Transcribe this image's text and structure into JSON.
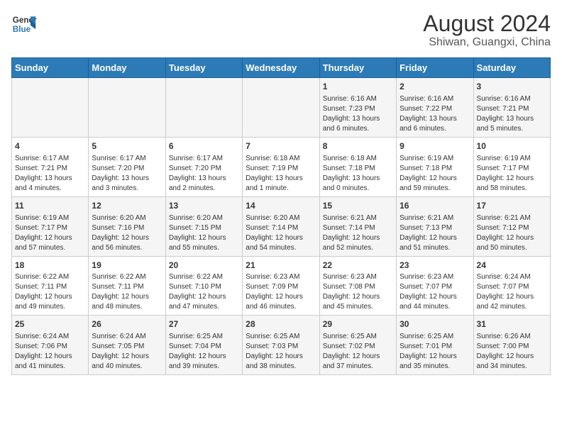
{
  "header": {
    "logo_line1": "General",
    "logo_line2": "Blue",
    "title": "August 2024",
    "subtitle": "Shiwan, Guangxi, China"
  },
  "days_of_week": [
    "Sunday",
    "Monday",
    "Tuesday",
    "Wednesday",
    "Thursday",
    "Friday",
    "Saturday"
  ],
  "weeks": [
    [
      {
        "day": "",
        "info": ""
      },
      {
        "day": "",
        "info": ""
      },
      {
        "day": "",
        "info": ""
      },
      {
        "day": "",
        "info": ""
      },
      {
        "day": "1",
        "info": "Sunrise: 6:16 AM\nSunset: 7:23 PM\nDaylight: 13 hours\nand 6 minutes."
      },
      {
        "day": "2",
        "info": "Sunrise: 6:16 AM\nSunset: 7:22 PM\nDaylight: 13 hours\nand 6 minutes."
      },
      {
        "day": "3",
        "info": "Sunrise: 6:16 AM\nSunset: 7:21 PM\nDaylight: 13 hours\nand 5 minutes."
      }
    ],
    [
      {
        "day": "4",
        "info": "Sunrise: 6:17 AM\nSunset: 7:21 PM\nDaylight: 13 hours\nand 4 minutes."
      },
      {
        "day": "5",
        "info": "Sunrise: 6:17 AM\nSunset: 7:20 PM\nDaylight: 13 hours\nand 3 minutes."
      },
      {
        "day": "6",
        "info": "Sunrise: 6:17 AM\nSunset: 7:20 PM\nDaylight: 13 hours\nand 2 minutes."
      },
      {
        "day": "7",
        "info": "Sunrise: 6:18 AM\nSunset: 7:19 PM\nDaylight: 13 hours\nand 1 minute."
      },
      {
        "day": "8",
        "info": "Sunrise: 6:18 AM\nSunset: 7:18 PM\nDaylight: 13 hours\nand 0 minutes."
      },
      {
        "day": "9",
        "info": "Sunrise: 6:19 AM\nSunset: 7:18 PM\nDaylight: 12 hours\nand 59 minutes."
      },
      {
        "day": "10",
        "info": "Sunrise: 6:19 AM\nSunset: 7:17 PM\nDaylight: 12 hours\nand 58 minutes."
      }
    ],
    [
      {
        "day": "11",
        "info": "Sunrise: 6:19 AM\nSunset: 7:17 PM\nDaylight: 12 hours\nand 57 minutes."
      },
      {
        "day": "12",
        "info": "Sunrise: 6:20 AM\nSunset: 7:16 PM\nDaylight: 12 hours\nand 56 minutes."
      },
      {
        "day": "13",
        "info": "Sunrise: 6:20 AM\nSunset: 7:15 PM\nDaylight: 12 hours\nand 55 minutes."
      },
      {
        "day": "14",
        "info": "Sunrise: 6:20 AM\nSunset: 7:14 PM\nDaylight: 12 hours\nand 54 minutes."
      },
      {
        "day": "15",
        "info": "Sunrise: 6:21 AM\nSunset: 7:14 PM\nDaylight: 12 hours\nand 52 minutes."
      },
      {
        "day": "16",
        "info": "Sunrise: 6:21 AM\nSunset: 7:13 PM\nDaylight: 12 hours\nand 51 minutes."
      },
      {
        "day": "17",
        "info": "Sunrise: 6:21 AM\nSunset: 7:12 PM\nDaylight: 12 hours\nand 50 minutes."
      }
    ],
    [
      {
        "day": "18",
        "info": "Sunrise: 6:22 AM\nSunset: 7:11 PM\nDaylight: 12 hours\nand 49 minutes."
      },
      {
        "day": "19",
        "info": "Sunrise: 6:22 AM\nSunset: 7:11 PM\nDaylight: 12 hours\nand 48 minutes."
      },
      {
        "day": "20",
        "info": "Sunrise: 6:22 AM\nSunset: 7:10 PM\nDaylight: 12 hours\nand 47 minutes."
      },
      {
        "day": "21",
        "info": "Sunrise: 6:23 AM\nSunset: 7:09 PM\nDaylight: 12 hours\nand 46 minutes."
      },
      {
        "day": "22",
        "info": "Sunrise: 6:23 AM\nSunset: 7:08 PM\nDaylight: 12 hours\nand 45 minutes."
      },
      {
        "day": "23",
        "info": "Sunrise: 6:23 AM\nSunset: 7:07 PM\nDaylight: 12 hours\nand 44 minutes."
      },
      {
        "day": "24",
        "info": "Sunrise: 6:24 AM\nSunset: 7:07 PM\nDaylight: 12 hours\nand 42 minutes."
      }
    ],
    [
      {
        "day": "25",
        "info": "Sunrise: 6:24 AM\nSunset: 7:06 PM\nDaylight: 12 hours\nand 41 minutes."
      },
      {
        "day": "26",
        "info": "Sunrise: 6:24 AM\nSunset: 7:05 PM\nDaylight: 12 hours\nand 40 minutes."
      },
      {
        "day": "27",
        "info": "Sunrise: 6:25 AM\nSunset: 7:04 PM\nDaylight: 12 hours\nand 39 minutes."
      },
      {
        "day": "28",
        "info": "Sunrise: 6:25 AM\nSunset: 7:03 PM\nDaylight: 12 hours\nand 38 minutes."
      },
      {
        "day": "29",
        "info": "Sunrise: 6:25 AM\nSunset: 7:02 PM\nDaylight: 12 hours\nand 37 minutes."
      },
      {
        "day": "30",
        "info": "Sunrise: 6:25 AM\nSunset: 7:01 PM\nDaylight: 12 hours\nand 35 minutes."
      },
      {
        "day": "31",
        "info": "Sunrise: 6:26 AM\nSunset: 7:00 PM\nDaylight: 12 hours\nand 34 minutes."
      }
    ]
  ]
}
